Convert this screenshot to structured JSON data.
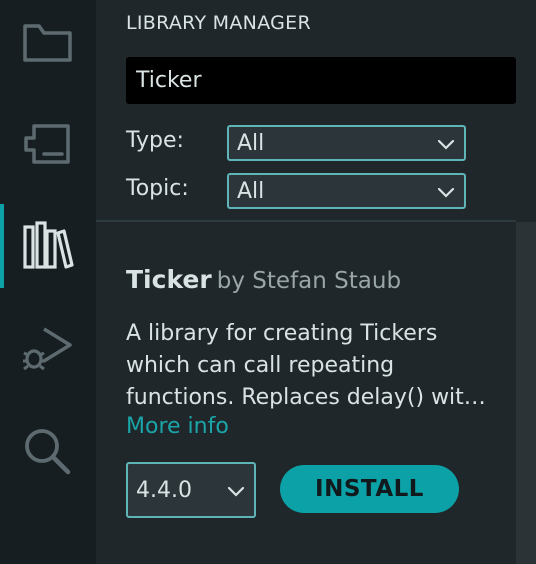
{
  "activity_bar": {
    "items": [
      {
        "name": "explorer",
        "icon": "folder-icon",
        "active": false
      },
      {
        "name": "board-manager",
        "icon": "board-icon",
        "active": false
      },
      {
        "name": "library-manager",
        "icon": "library-icon",
        "active": true
      },
      {
        "name": "debug",
        "icon": "debug-icon",
        "active": false
      },
      {
        "name": "search",
        "icon": "search-icon",
        "active": false
      }
    ]
  },
  "panel": {
    "title": "LIBRARY MANAGER",
    "search": {
      "value": "Ticker",
      "placeholder": ""
    },
    "filters": {
      "type_label": "Type:",
      "type_value": "All",
      "topic_label": "Topic:",
      "topic_value": "All"
    }
  },
  "library": {
    "name": "Ticker",
    "by": "by Stefan Staub",
    "description_lines": [
      "A library for creating Tickers",
      "which can call repeating",
      "functions. Replaces delay() wit…"
    ],
    "more_info": "More info",
    "version": "4.4.0",
    "install_label": "INSTALL"
  },
  "colors": {
    "accent": "#0ca1a6",
    "background": "#1f272a",
    "sidebar": "#171e21",
    "text": "#dae3e3",
    "muted": "#9aa5a7"
  }
}
